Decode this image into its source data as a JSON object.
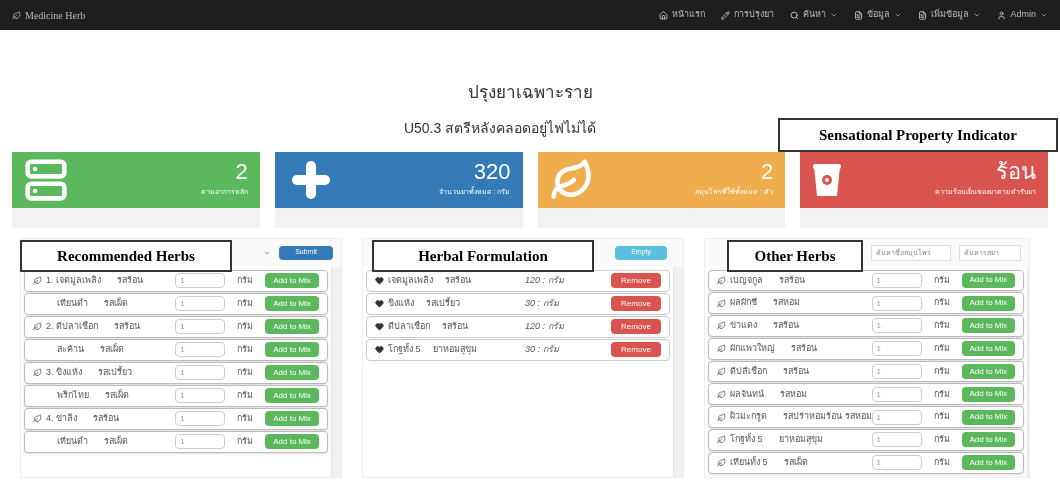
{
  "navbar": {
    "brand": "Medicine Herb",
    "items": [
      {
        "kind": "home",
        "label": "หน้าแรก",
        "dropdown": false
      },
      {
        "kind": "pencil",
        "label": "การปรุงยา",
        "dropdown": false
      },
      {
        "kind": "search",
        "label": "ค้นหา",
        "dropdown": true
      },
      {
        "kind": "file",
        "label": "ข้อมูล",
        "dropdown": true
      },
      {
        "kind": "file",
        "label": "เพิ่มข้อมูล",
        "dropdown": true
      },
      {
        "kind": "user",
        "label": "Admin",
        "dropdown": true
      }
    ]
  },
  "page_title": "ปรุงยาเฉพาะราย",
  "diagnosis": "U50.3 สตรีหลังคลอดอยู่ไฟไม่ได้",
  "stat_cards": [
    {
      "kind": "server",
      "color": "#5cb85c",
      "value": "2",
      "caption": "ตามอาการหลัก"
    },
    {
      "kind": "plus",
      "color": "#337ab7",
      "value": "320",
      "caption": "จำนวนยาทั้งหมด : กรัม"
    },
    {
      "kind": "leaf",
      "color": "#f0ad4e",
      "value": "2",
      "caption": "สมุนไพรที่ใช้ทั้งหมด : ตัว"
    },
    {
      "kind": "bucket",
      "color": "#d9534f",
      "value": "ร้อน",
      "caption": "ความร้อนเย็นของยาตามตำรับยา"
    }
  ],
  "recommended": {
    "submit": "Submit",
    "rows": [
      {
        "kind": "main",
        "name": "1. เจตมูลเพลิง",
        "taste": "รสร้อน",
        "amount": "1",
        "unit": "กรัม",
        "button": "Add to Mix"
      },
      {
        "kind": "sub",
        "name": "เทียนดำ",
        "taste": "รสเผ็ด",
        "amount": "1",
        "unit": "กรัม",
        "button": "Add to Mix"
      },
      {
        "kind": "main",
        "name": "2. ดีปลาเชือก",
        "taste": "รสร้อน",
        "amount": "1",
        "unit": "กรัม",
        "button": "Add to Mix"
      },
      {
        "kind": "sub",
        "name": "สะค้าน",
        "taste": "รสเผ็ด",
        "amount": "1",
        "unit": "กรัม",
        "button": "Add to Mix"
      },
      {
        "kind": "main",
        "name": "3. ขิงแห้ง",
        "taste": "รสเปรี้ยว",
        "amount": "1",
        "unit": "กรัม",
        "button": "Add to Mix"
      },
      {
        "kind": "sub",
        "name": "พริกไทย",
        "taste": "รสเผ็ด",
        "amount": "1",
        "unit": "กรัม",
        "button": "Add to Mix"
      },
      {
        "kind": "main",
        "name": "4. ข่าลิง",
        "taste": "รสร้อน",
        "amount": "1",
        "unit": "กรัม",
        "button": "Add to Mix"
      },
      {
        "kind": "sub",
        "name": "เทียนดำ",
        "taste": "รสเผ็ด",
        "amount": "1",
        "unit": "กรัม",
        "button": "Add to Mix"
      }
    ]
  },
  "formulation": {
    "empty_button": "Empty",
    "rows": [
      {
        "name": "เจตมูลเพลิง",
        "taste": "รสร้อน",
        "amount": "120 : กรัม",
        "button": "Remove"
      },
      {
        "name": "ขิงแห้ง",
        "taste": "รสเปรี้ยว",
        "amount": "30 : กรัม",
        "button": "Remove"
      },
      {
        "name": "ดีปลาเชือก",
        "taste": "รสร้อน",
        "amount": "120 : กรัม",
        "button": "Remove"
      },
      {
        "name": "โกฐทั้ง 5",
        "taste": "ยาหอมสุขุม",
        "amount": "30 : กรัม",
        "button": "Remove"
      }
    ]
  },
  "other_herbs": {
    "search_name_placeholder": "ค้นหาชื่อสมุนไพร",
    "search_taste_placeholder": "ค้นหารสยา",
    "rows": [
      {
        "name": "เบญจกูล",
        "taste": "รสร้อน",
        "amount": "1",
        "unit": "กรัม",
        "button": "Add to Mix"
      },
      {
        "name": "ผลผักชี",
        "taste": "รสหอม",
        "amount": "1",
        "unit": "กรัม",
        "button": "Add to Mix"
      },
      {
        "name": "ข่าแดง",
        "taste": "รสร้อน",
        "amount": "1",
        "unit": "กรัม",
        "button": "Add to Mix"
      },
      {
        "name": "ผักแพวใหญ่",
        "taste": "รสร้อน",
        "amount": "1",
        "unit": "กรัม",
        "button": "Add to Mix"
      },
      {
        "name": "ดีปลีเชือก",
        "taste": "รสร้อน",
        "amount": "1",
        "unit": "กรัม",
        "button": "Add to Mix"
      },
      {
        "name": "ผลจันทน์",
        "taste": "รสหอม",
        "amount": "1",
        "unit": "กรัม",
        "button": "Add to Mix"
      },
      {
        "name": "ผิวมะกรูด",
        "taste": "รสปร่าหอมร้อน รสหอม",
        "amount": "1",
        "unit": "กรัม",
        "button": "Add to Mix"
      },
      {
        "name": "โกฐทั้ง 5",
        "taste": "ยาหอมสุขุม",
        "amount": "1",
        "unit": "กรัม",
        "button": "Add to Mix"
      },
      {
        "name": "เทียนทั้ง 5",
        "taste": "รสเผ็ด",
        "amount": "1",
        "unit": "กรัม",
        "button": "Add to Mix"
      }
    ]
  },
  "annotations": [
    {
      "kind": "property",
      "label": "Sensational Property Indicator"
    },
    {
      "kind": "recommended",
      "label": "Recommended Herbs"
    },
    {
      "kind": "formulation",
      "label": "Herbal Formulation"
    },
    {
      "kind": "other",
      "label": "Other Herbs"
    }
  ]
}
